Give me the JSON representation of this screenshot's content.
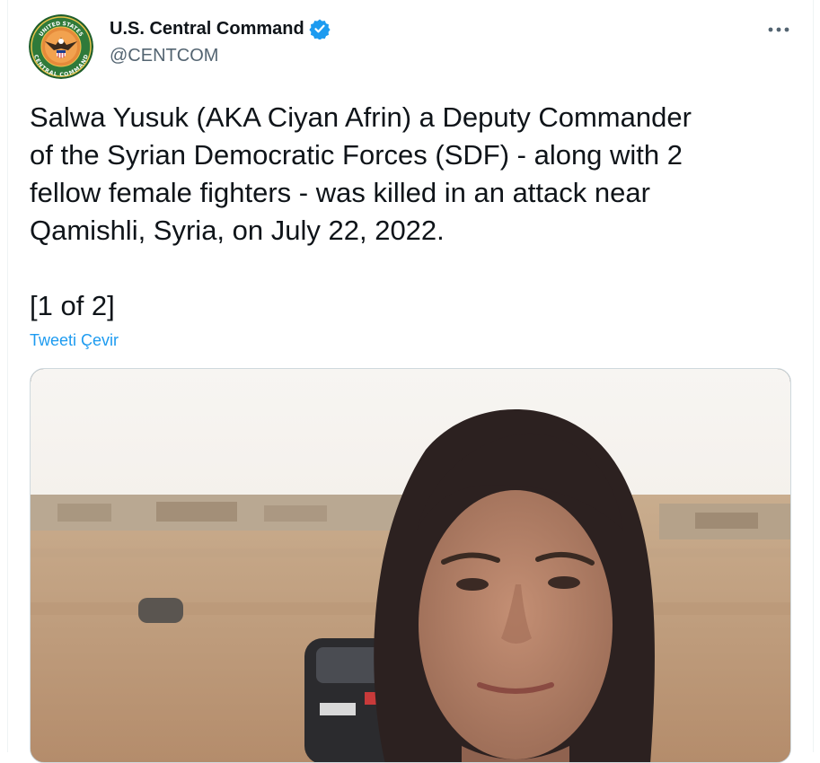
{
  "tweet": {
    "author": {
      "display_name": "U.S. Central Command",
      "handle": "@CENTCOM",
      "verified": true,
      "avatar_icon": "centcom-seal-icon",
      "avatar_text_top": "UNITED STATES",
      "avatar_text_bottom": "CENTRAL COMMAND"
    },
    "more_icon": "more-icon",
    "text": "Salwa Yusuk (AKA Ciyan Afrin) a Deputy Commander\nof the Syrian Democratic Forces (SDF) - along with 2\nfellow female fighters - was killed in an attack near\nQamishli, Syria, on July 22, 2022.",
    "counter": "[1 of 2]",
    "translate_link": "Tweeti Çevir",
    "colors": {
      "link": "#1d9bf0",
      "verified": "#1d9bf0",
      "secondary_text": "#536471"
    }
  }
}
